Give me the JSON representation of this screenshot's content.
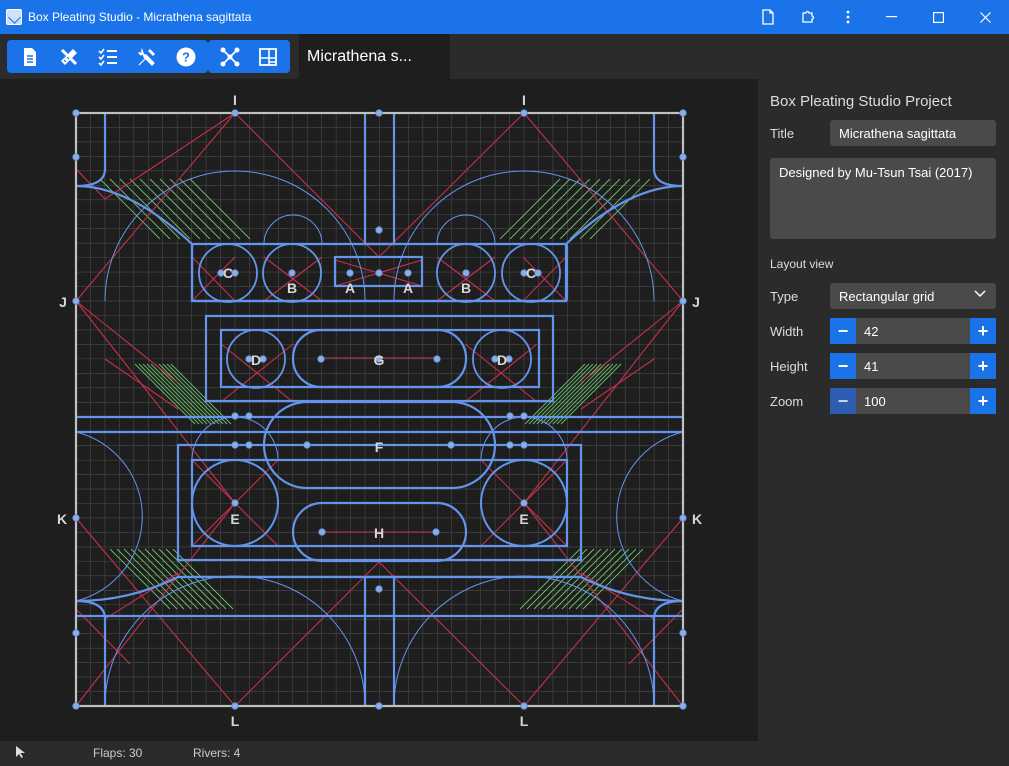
{
  "window": {
    "title": "Box Pleating Studio - Micrathena sagittata"
  },
  "toolbar": {
    "file_icon": "file-icon",
    "tools_icon": "pencil-ruler-icon",
    "checklist_icon": "checklist-icon",
    "settings_icon": "wrench-screwdriver-icon",
    "help_icon": "help-icon",
    "tree_view_icon": "tree-view-icon",
    "layout_view_icon": "layout-view-icon"
  },
  "tabs": [
    {
      "label": "Micrathena s..."
    }
  ],
  "panel": {
    "title": "Box Pleating Studio Project",
    "title_label": "Title",
    "title_value": "Micrathena sagittata",
    "description": "Designed by Mu-Tsun Tsai (2017)",
    "section_layout": "Layout view",
    "type_label": "Type",
    "type_value": "Rectangular grid",
    "width_label": "Width",
    "width_value": "42",
    "height_label": "Height",
    "height_value": "41",
    "zoom_label": "Zoom",
    "zoom_value": "100"
  },
  "canvas_labels": {
    "I": "I",
    "J": "J",
    "K": "K",
    "L": "L",
    "A": "A",
    "B": "B",
    "C": "C",
    "D": "D",
    "E": "E",
    "F": "F",
    "G": "G",
    "H": "H"
  },
  "status": {
    "flaps": "Flaps: 30",
    "rivers": "Rivers: 4"
  },
  "colors": {
    "accent": "#1a73e8",
    "river": "#6495ed",
    "crease_red": "#c8304a",
    "hinge_green": "#6ac06a",
    "border": "#c0c0c0"
  }
}
